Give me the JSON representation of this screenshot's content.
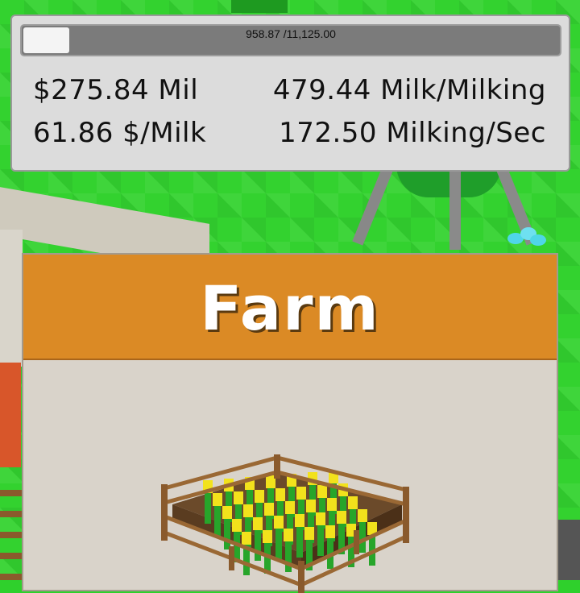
{
  "progress": {
    "current": "958.87",
    "target": "11,125.00",
    "text": "958.87 /11,125.00",
    "fraction": 0.086
  },
  "stats": {
    "money": "$275.84 Mil",
    "price_per_milk": "61.86 $/Milk",
    "milk_per_milking": "479.44  Milk/Milking",
    "milking_per_sec": "172.50  Milking/Sec"
  },
  "farm_card": {
    "title": "Farm",
    "icon": "crop-field-icon"
  },
  "colors": {
    "grass": "#33d22f",
    "header": "#db8a25",
    "card_body": "#d9d3ca",
    "panel": "#dcdcdc"
  }
}
